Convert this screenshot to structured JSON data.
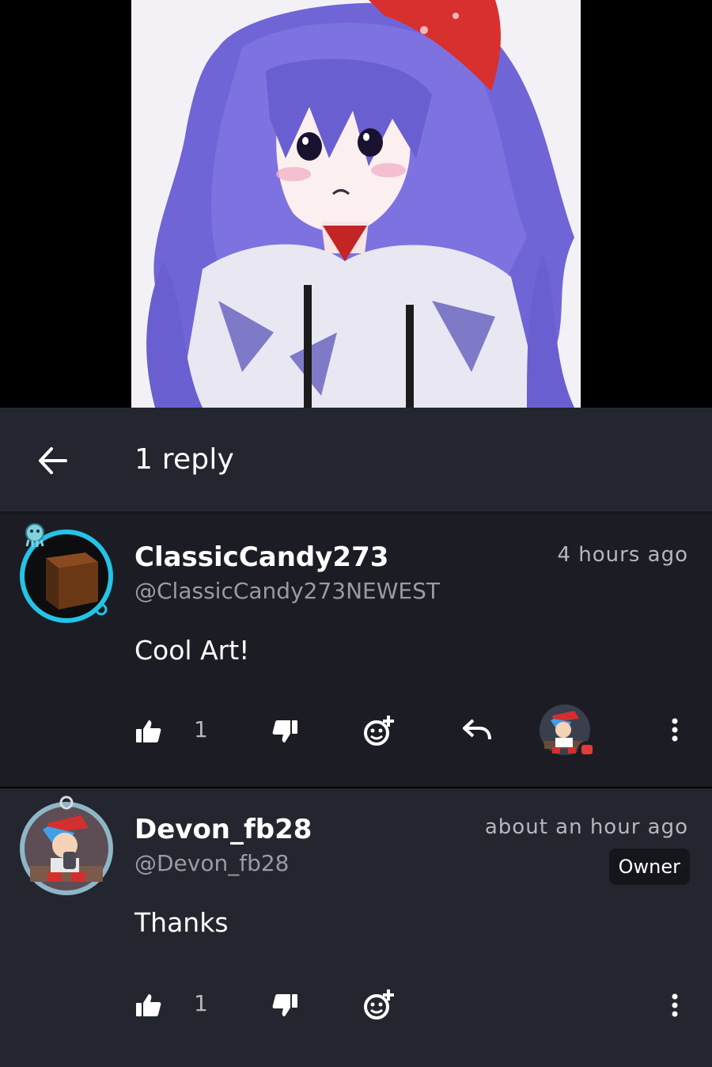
{
  "header": {
    "title": "1 reply"
  },
  "comments": [
    {
      "username": "ClassicCandy273",
      "handle": "@ClassicCandy273NEWEST",
      "time": "4 hours ago",
      "text": "Cool Art!",
      "likes": "1"
    },
    {
      "username": "Devon_fb28",
      "handle": "@Devon_fb28",
      "time": "about an hour ago",
      "badge": "Owner",
      "text": "Thanks",
      "likes": "1"
    }
  ],
  "icons": {
    "back": "arrow-left-icon",
    "like": "thumbs-up-icon",
    "dislike": "thumbs-down-icon",
    "react": "add-emoji-icon",
    "reply": "reply-icon",
    "more": "more-vertical-icon"
  },
  "colors": {
    "background": "#000000",
    "header": "#24262f",
    "comment_dark": "#1c1d24",
    "comment_light": "#24262f",
    "muted_text": "#9a9ba2"
  }
}
